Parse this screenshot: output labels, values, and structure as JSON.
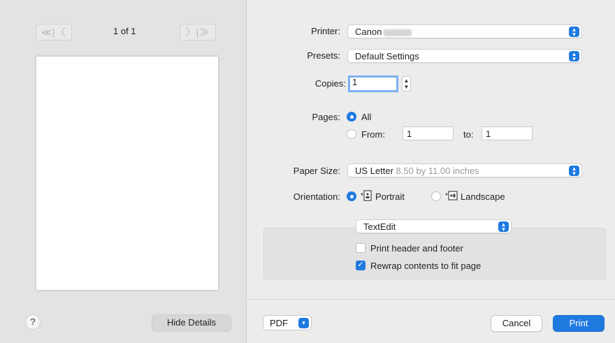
{
  "preview_pane": {
    "prev_buttons": "≪|〈",
    "page_counter": "1 of 1",
    "next_buttons": "〉|≫",
    "help_label": "?",
    "hide_details_label": "Hide Details"
  },
  "printer": {
    "label": "Printer:",
    "value": "Canon"
  },
  "presets": {
    "label": "Presets:",
    "value": "Default Settings"
  },
  "copies": {
    "label": "Copies:",
    "value": "1"
  },
  "pages": {
    "label": "Pages:",
    "all_label": "All",
    "from_label": "From:",
    "from_value": "1",
    "to_label": "to:",
    "to_value": "1",
    "selected": "All"
  },
  "paper_size": {
    "label": "Paper Size:",
    "value": "US Letter",
    "detail": "8.50 by 11.00 inches"
  },
  "orientation": {
    "label": "Orientation:",
    "portrait_label": "Portrait",
    "landscape_label": "Landscape",
    "selected": "Portrait"
  },
  "app_section": {
    "popup_value": "TextEdit",
    "print_header_footer_label": "Print header and footer",
    "print_header_footer_checked": false,
    "rewrap_label": "Rewrap contents to fit page",
    "rewrap_checked": true
  },
  "footer": {
    "pdf_label": "PDF",
    "cancel_label": "Cancel",
    "print_label": "Print"
  },
  "colors": {
    "accent": "#1f7ae0",
    "background": "#ececec",
    "preview_pane": "#e3e3e3"
  },
  "icons": {
    "popup_arrows": "up-down-chevron-icon",
    "portrait": "portrait-orientation-icon",
    "landscape": "landscape-orientation-icon",
    "pdf_dropdown": "chevron-down-icon"
  }
}
